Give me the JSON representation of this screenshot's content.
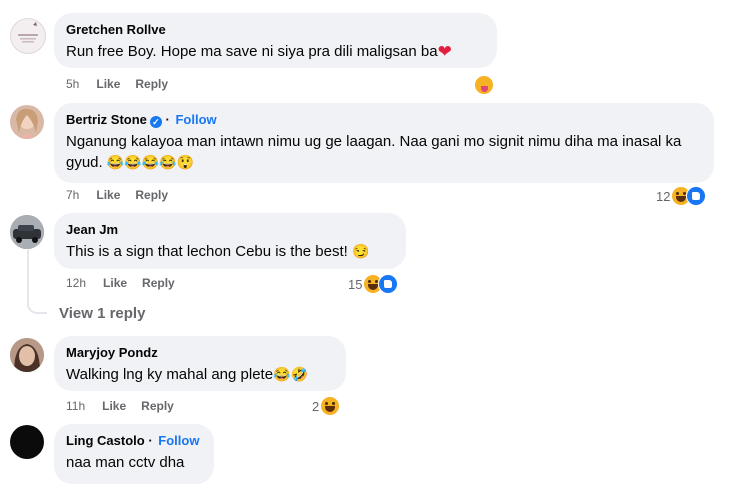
{
  "comments": [
    {
      "author": "Gretchen Rollve",
      "text": "Run free Boy. Hope ma save ni siya pra dili maligsan ba",
      "time": "5h",
      "like": "Like",
      "reply": "Reply",
      "reaction_count": ""
    },
    {
      "author": "Bertriz Stone",
      "follow": "Follow",
      "verified": true,
      "text": "Nganung kalayoa man intawn nimu ug ge laagan. Naa gani mo signit nimu diha ma inasal ka gyud.",
      "time": "7h",
      "like": "Like",
      "reply": "Reply",
      "reaction_count": "12"
    },
    {
      "author": "Jean Jm",
      "text": "This is a sign that lechon Cebu is the best!",
      "time": "12h",
      "like": "Like",
      "reply": "Reply",
      "reaction_count": "15"
    },
    {
      "author": "Maryjoy Pondz",
      "text": "Walking lng ky mahal ang plete",
      "time": "11h",
      "like": "Like",
      "reply": "Reply",
      "reaction_count": "2"
    },
    {
      "author": "Ling Castolo",
      "follow": "Follow",
      "text": "naa man cctv dha"
    }
  ],
  "view_replies": "View 1 reply",
  "icons": {
    "reaction_haha": "haha-reaction-icon",
    "reaction_like": "like-reaction-icon",
    "verified": "verified-badge-icon"
  },
  "colors": {
    "bubble": "#f0f2f5",
    "link": "#1877f2",
    "meta": "#65676b"
  }
}
